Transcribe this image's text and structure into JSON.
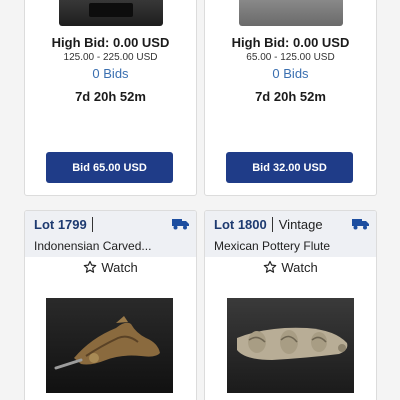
{
  "top_cards": [
    {
      "high_bid": "High Bid: 0.00 USD",
      "estimate": "125.00 - 225.00 USD",
      "bids": "0 Bids",
      "time_left": "7d 20h 52m",
      "bid_button": "Bid 65.00 USD"
    },
    {
      "high_bid": "High Bid: 0.00 USD",
      "estimate": "65.00 - 125.00 USD",
      "bids": "0 Bids",
      "time_left": "7d 20h 52m",
      "bid_button": "Bid 32.00 USD"
    }
  ],
  "bottom_cards": [
    {
      "lot": "Lot 1799",
      "tag": "",
      "title": "Indonensian Carved...",
      "watch": "Watch",
      "shipping_icon": "truck-icon",
      "watch_icon": "star-outline-icon"
    },
    {
      "lot": "Lot 1800",
      "tag": "Vintage",
      "title": "Mexican Pottery Flute",
      "watch": "Watch",
      "shipping_icon": "truck-icon",
      "watch_icon": "star-outline-icon"
    }
  ],
  "colors": {
    "bid_button": "#1f3c88",
    "bids_link": "#3a6fb0",
    "lot_number": "#1d3a70",
    "header_bg": "#eef0f4"
  }
}
